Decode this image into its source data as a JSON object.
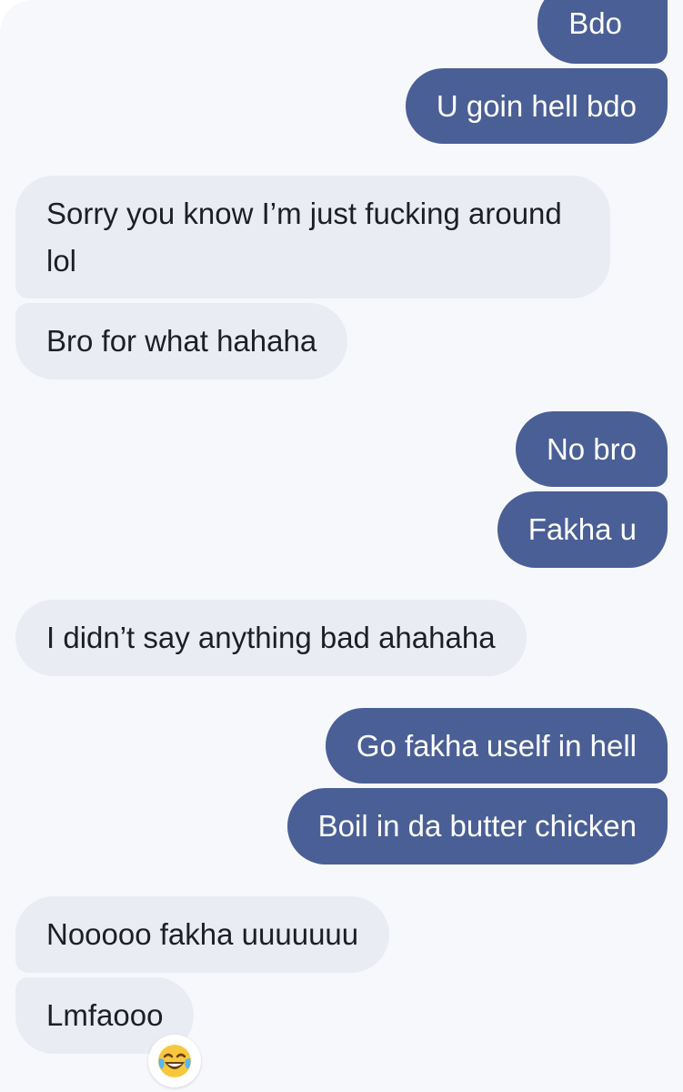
{
  "messages": [
    {
      "direction": "out",
      "text": "Bdo"
    },
    {
      "direction": "out",
      "text": "U goin hell bdo"
    },
    {
      "direction": "in",
      "text": "Sorry you know I’m just fucking around lol"
    },
    {
      "direction": "in",
      "text": "Bro for what hahaha"
    },
    {
      "direction": "out",
      "text": "No bro"
    },
    {
      "direction": "out",
      "text": "Fakha u"
    },
    {
      "direction": "in",
      "text": "I didn’t say anything bad ahahaha"
    },
    {
      "direction": "out",
      "text": "Go fakha uself in hell"
    },
    {
      "direction": "out",
      "text": "Boil in da butter chicken"
    },
    {
      "direction": "in",
      "text": "Nooooo fakha uuuuuuu"
    },
    {
      "direction": "in",
      "text": "Lmfaooo",
      "reaction": "face-with-tears-of-joy-icon"
    }
  ],
  "colors": {
    "outgoing_bubble": "#4a5f96",
    "incoming_bubble": "#e9ecf3",
    "background": "#f7f8fc"
  }
}
